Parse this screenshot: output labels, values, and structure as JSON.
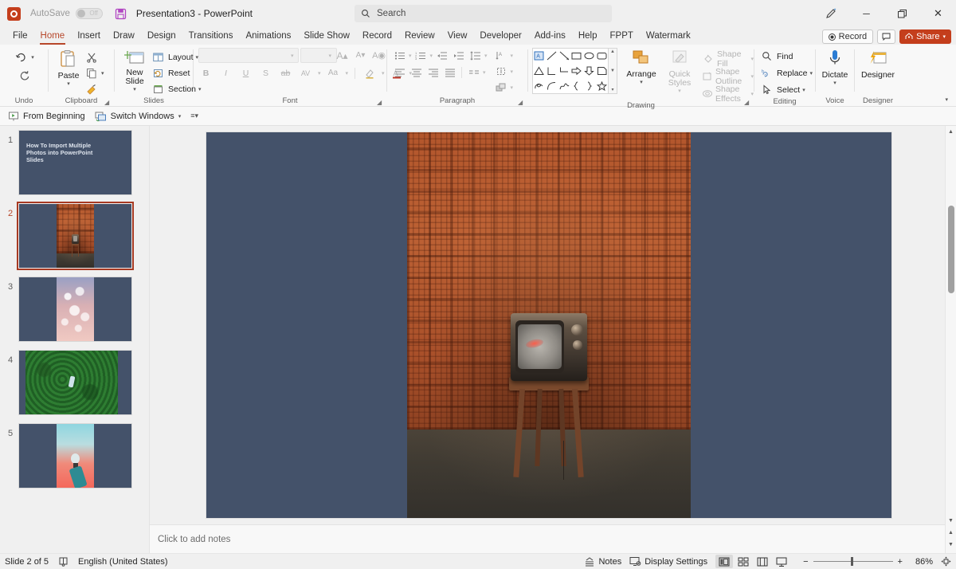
{
  "titlebar": {
    "app_icon": "powerpoint-logo",
    "autosave_label": "AutoSave",
    "autosave_state": "Off",
    "save_icon": "save-icon",
    "document_title": "Presentation3  -  PowerPoint",
    "search_placeholder": "Search",
    "pen_icon": "pen-annotate-icon",
    "minimize": "─",
    "restore": "❐",
    "close": "✕"
  },
  "tabs": [
    {
      "label": "File",
      "active": false
    },
    {
      "label": "Home",
      "active": true
    },
    {
      "label": "Insert",
      "active": false
    },
    {
      "label": "Draw",
      "active": false
    },
    {
      "label": "Design",
      "active": false
    },
    {
      "label": "Transitions",
      "active": false
    },
    {
      "label": "Animations",
      "active": false
    },
    {
      "label": "Slide Show",
      "active": false
    },
    {
      "label": "Record",
      "active": false
    },
    {
      "label": "Review",
      "active": false
    },
    {
      "label": "View",
      "active": false
    },
    {
      "label": "Developer",
      "active": false
    },
    {
      "label": "Add-ins",
      "active": false
    },
    {
      "label": "Help",
      "active": false
    },
    {
      "label": "FPPT",
      "active": false
    },
    {
      "label": "Watermark",
      "active": false
    }
  ],
  "tabstrip_right": {
    "record_label": "Record",
    "comments_icon": "comment-icon",
    "share_label": "Share"
  },
  "ribbon": {
    "groups": [
      {
        "name": "Undo",
        "label": "Undo",
        "items": [
          {
            "label": "Undo",
            "icon": "undo-arrow-icon"
          },
          {
            "label": "Redo",
            "icon": "redo-arrow-icon"
          }
        ]
      },
      {
        "name": "Clipboard",
        "label": "Clipboard",
        "items": [
          {
            "label": "Paste",
            "icon": "clipboard-icon"
          },
          {
            "label": "Cut",
            "icon": "scissors-icon"
          },
          {
            "label": "Copy",
            "icon": "copy-icon"
          },
          {
            "label": "Format Painter",
            "icon": "format-painter-icon"
          }
        ]
      },
      {
        "name": "Slides",
        "label": "Slides",
        "items": [
          {
            "label": "New Slide",
            "icon": "new-slide-icon"
          },
          {
            "label": "Layout",
            "icon": "layout-icon"
          },
          {
            "label": "Reset",
            "icon": "reset-icon"
          },
          {
            "label": "Section",
            "icon": "section-icon"
          }
        ]
      },
      {
        "name": "Font",
        "label": "Font",
        "font_name_value": "",
        "font_size_value": "",
        "items": [
          {
            "label": "Increase Font Size",
            "icon": "increase-font-icon"
          },
          {
            "label": "Decrease Font Size",
            "icon": "decrease-font-icon"
          },
          {
            "label": "Clear All Formatting",
            "icon": "clear-formatting-icon"
          },
          {
            "label": "Bold",
            "icon": "bold-icon"
          },
          {
            "label": "Italic",
            "icon": "italic-icon"
          },
          {
            "label": "Underline",
            "icon": "underline-icon"
          },
          {
            "label": "Text Shadow",
            "icon": "text-shadow-icon"
          },
          {
            "label": "Strikethrough",
            "icon": "strikethrough-icon"
          },
          {
            "label": "Character Spacing",
            "icon": "character-spacing-icon"
          },
          {
            "label": "Change Case",
            "icon": "change-case-icon"
          },
          {
            "label": "Text Highlight Color",
            "icon": "highlight-color-icon"
          },
          {
            "label": "Font Color",
            "icon": "font-color-icon"
          }
        ]
      },
      {
        "name": "Paragraph",
        "label": "Paragraph",
        "items": [
          {
            "label": "Bullets",
            "icon": "bullets-icon"
          },
          {
            "label": "Numbering",
            "icon": "numbering-icon"
          },
          {
            "label": "Decrease List Level",
            "icon": "decrease-indent-icon"
          },
          {
            "label": "Increase List Level",
            "icon": "increase-indent-icon"
          },
          {
            "label": "Line Spacing",
            "icon": "line-spacing-icon"
          },
          {
            "label": "Text Direction",
            "icon": "text-direction-icon"
          },
          {
            "label": "Align Text",
            "icon": "align-text-icon"
          },
          {
            "label": "Convert to SmartArt",
            "icon": "smartart-icon"
          },
          {
            "label": "Align Left",
            "icon": "align-left-icon"
          },
          {
            "label": "Center",
            "icon": "align-center-icon"
          },
          {
            "label": "Align Right",
            "icon": "align-right-icon"
          },
          {
            "label": "Justify",
            "icon": "justify-icon"
          },
          {
            "label": "Columns",
            "icon": "columns-icon"
          }
        ]
      },
      {
        "name": "Drawing",
        "label": "Drawing",
        "items": [
          {
            "label": "Shapes Gallery",
            "icon": "shapes-gallery-icon"
          },
          {
            "label": "Arrange",
            "icon": "arrange-icon"
          },
          {
            "label": "Quick Styles",
            "icon": "quick-styles-icon"
          },
          {
            "label": "Shape Fill",
            "icon": "shape-fill-icon"
          },
          {
            "label": "Shape Outline",
            "icon": "shape-outline-icon"
          },
          {
            "label": "Shape Effects",
            "icon": "shape-effects-icon"
          }
        ]
      },
      {
        "name": "Editing",
        "label": "Editing",
        "items": [
          {
            "label": "Find",
            "icon": "search-icon"
          },
          {
            "label": "Replace",
            "icon": "replace-icon"
          },
          {
            "label": "Select",
            "icon": "select-pointer-icon"
          }
        ]
      },
      {
        "name": "Voice",
        "label": "Voice",
        "items": [
          {
            "label": "Dictate",
            "icon": "microphone-icon"
          }
        ]
      },
      {
        "name": "Designer",
        "label": "Designer",
        "items": [
          {
            "label": "Designer",
            "icon": "designer-icon"
          }
        ]
      }
    ],
    "collapse_icon": "chevron-down-icon"
  },
  "quick_toolbar": {
    "from_beginning": "From Beginning",
    "switch_windows": "Switch Windows",
    "more": "more-options-icon"
  },
  "thumbnails": {
    "slides": [
      {
        "number": "1",
        "selected": false,
        "title": "How To Import Multiple Photos into PowerPoint Slides",
        "image": "none"
      },
      {
        "number": "2",
        "selected": true,
        "title": "",
        "image": "vintage-tv-orange-wallpaper"
      },
      {
        "number": "3",
        "selected": false,
        "title": "",
        "image": "pink-bokeh-lights"
      },
      {
        "number": "4",
        "selected": false,
        "title": "",
        "image": "aerial-forest-person"
      },
      {
        "number": "5",
        "selected": false,
        "title": "",
        "image": "hand-holding-lightbulb"
      }
    ]
  },
  "canvas": {
    "slide_image_alt": "vintage television on wooden stool against orange plaid wallpaper",
    "background_color": "#44526a",
    "notes_placeholder": "Click to add notes"
  },
  "statusbar": {
    "slide_counter": "Slide 2 of 5",
    "accessibility_icon": "accessibility-checker-icon",
    "language": "English (United States)",
    "notes_label": "Notes",
    "display_settings_label": "Display Settings",
    "views": [
      {
        "name": "Normal",
        "icon": "normal-view-icon",
        "active": true
      },
      {
        "name": "Slide Sorter",
        "icon": "slide-sorter-icon",
        "active": false
      },
      {
        "name": "Reading View",
        "icon": "reading-view-icon",
        "active": false
      },
      {
        "name": "Slide Show",
        "icon": "slide-show-icon",
        "active": false
      }
    ],
    "zoom_out": "−",
    "zoom_in": "+",
    "zoom_level": "86%",
    "fit_icon": "fit-to-window-icon"
  },
  "colors": {
    "accent_red": "#b7472a",
    "share_red": "#c43e1c",
    "slide_blue": "#44526a",
    "ribbon_bg": "#f8f8f8",
    "chrome_bg": "#f0f0f0"
  }
}
